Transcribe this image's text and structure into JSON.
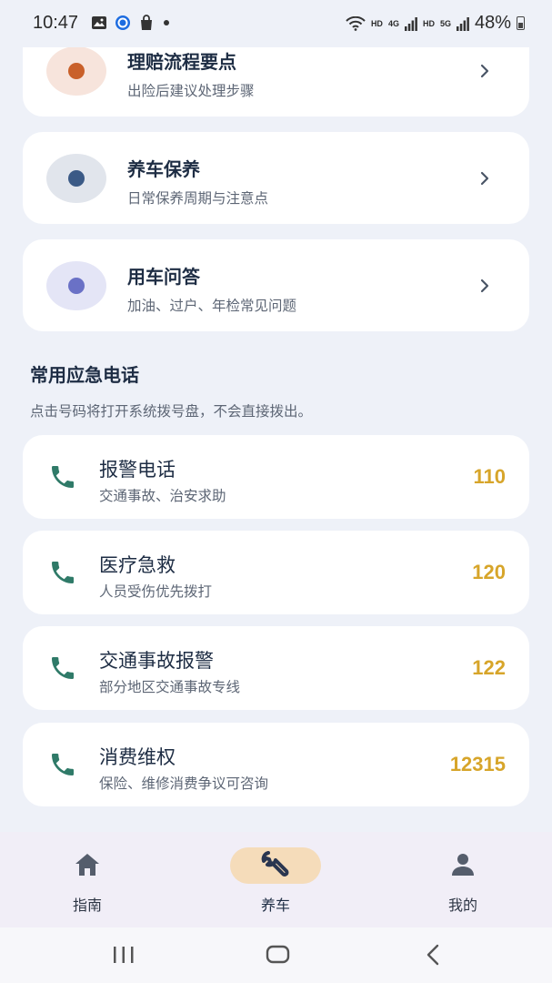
{
  "status_bar": {
    "time": "10:47",
    "net_label_1": "HD",
    "net_label_2": "4G",
    "net_label_3": "HD",
    "net_label_4": "5G",
    "battery": "48%"
  },
  "guide_items": [
    {
      "title": "理赔流程要点",
      "subtitle": "出险后建议处理步骤",
      "circle_color": "#f7e4dc",
      "dot_color": "#c9602a"
    },
    {
      "title": "养车保养",
      "subtitle": "日常保养周期与注意点",
      "circle_color": "#e1e5ec",
      "dot_color": "#3b5a86"
    },
    {
      "title": "用车问答",
      "subtitle": "加油、过户、年检常见问题",
      "circle_color": "#e4e5f6",
      "dot_color": "#6a71c6"
    }
  ],
  "emergency": {
    "title": "常用应急电话",
    "note": "点击号码将打开系统拨号盘，不会直接拨出。",
    "items": [
      {
        "title": "报警电话",
        "subtitle": "交通事故、治安求助",
        "number": "110"
      },
      {
        "title": "医疗急救",
        "subtitle": "人员受伤优先拨打",
        "number": "120"
      },
      {
        "title": "交通事故报警",
        "subtitle": "部分地区交通事故专线",
        "number": "122"
      },
      {
        "title": "消费维权",
        "subtitle": "保险、维修消费争议可咨询",
        "number": "12315"
      }
    ]
  },
  "bottom_nav": {
    "items": [
      {
        "label": "指南",
        "icon": "home-icon"
      },
      {
        "label": "养车",
        "icon": "wrench-icon",
        "active": true
      },
      {
        "label": "我的",
        "icon": "person-icon"
      }
    ]
  },
  "colors": {
    "accent_number": "#d7a52a",
    "phone_icon": "#2f7a68",
    "nav_active_pill": "#f5dcba"
  }
}
